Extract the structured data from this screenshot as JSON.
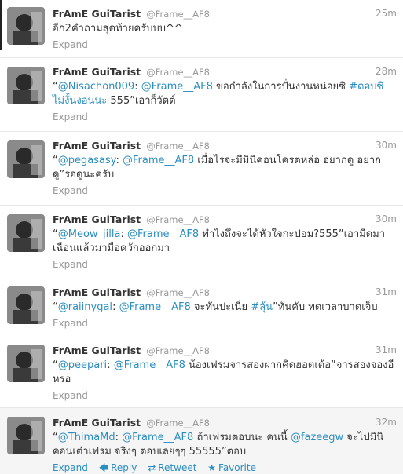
{
  "tweets": [
    {
      "name": "FrAmE GuiTarist",
      "handle": "@Frame__AF8",
      "time": "25m",
      "text_parts": [
        {
          "t": "อีก2คำถามสุดท้ายครับบบ^^",
          "k": "text"
        }
      ],
      "expand": "Expand"
    },
    {
      "name": "FrAmE GuiTarist",
      "handle": "@Frame__AF8",
      "time": "28m",
      "text_parts": [
        {
          "t": "“",
          "k": "text"
        },
        {
          "t": "@Nisachon009",
          "k": "mention"
        },
        {
          "t": ": ",
          "k": "text"
        },
        {
          "t": "@Frame__AF8",
          "k": "mention"
        },
        {
          "t": " ขอกำลังในการปั่นงานหน่อยซิ ",
          "k": "text"
        },
        {
          "t": "#ตอบซิ",
          "k": "mention"
        },
        {
          "t": " ",
          "k": "text"
        },
        {
          "t": "ไม่งั้นงอนนะ",
          "k": "mention"
        },
        {
          "t": " 555”เอาก็วัตต์",
          "k": "text"
        }
      ],
      "expand": "Expand"
    },
    {
      "name": "FrAmE GuiTarist",
      "handle": "@Frame__AF8",
      "time": "30m",
      "text_parts": [
        {
          "t": "“",
          "k": "text"
        },
        {
          "t": "@pegasasy",
          "k": "mention"
        },
        {
          "t": ": ",
          "k": "text"
        },
        {
          "t": "@Frame__AF8",
          "k": "mention"
        },
        {
          "t": " เมื่อไรจะมีมินิคอนโครตหล่อ อยากดู อยากดู”รอดูนะครับ",
          "k": "text"
        }
      ],
      "expand": "Expand"
    },
    {
      "name": "FrAmE GuiTarist",
      "handle": "@Frame__AF8",
      "time": "30m",
      "text_parts": [
        {
          "t": "“",
          "k": "text"
        },
        {
          "t": "@Meow_jilla",
          "k": "mention"
        },
        {
          "t": ": ",
          "k": "text"
        },
        {
          "t": "@Frame__AF8",
          "k": "mention"
        },
        {
          "t": " ทำไงถึงจะได้หัวใจกะปอม?555”เอามีดมาเฉือนแล้วมามือควักออกมา",
          "k": "text"
        }
      ],
      "expand": "Expand"
    },
    {
      "name": "FrAmE GuiTarist",
      "handle": "@Frame__AF8",
      "time": "31m",
      "text_parts": [
        {
          "t": "“",
          "k": "text"
        },
        {
          "t": "@raiinygal",
          "k": "mention"
        },
        {
          "t": ": ",
          "k": "text"
        },
        {
          "t": "@Frame__AF8",
          "k": "mention"
        },
        {
          "t": " จะทันปะเนี่ย ",
          "k": "text"
        },
        {
          "t": "#ลุ้น",
          "k": "mention"
        },
        {
          "t": "”ทันคับ ทดเวลาบาดเจ็บ",
          "k": "text"
        }
      ],
      "expand": "Expand"
    },
    {
      "name": "FrAmE GuiTarist",
      "handle": "@Frame__AF8",
      "time": "31m",
      "text_parts": [
        {
          "t": "“",
          "k": "text"
        },
        {
          "t": "@peepari",
          "k": "mention"
        },
        {
          "t": ": ",
          "k": "text"
        },
        {
          "t": "@Frame__AF8",
          "k": "mention"
        },
        {
          "t": " น้องเฟรมจารสองฝากคิดฮอตเต้อ”จารสองจองอีหรอ",
          "k": "text"
        }
      ],
      "expand": "Expand"
    },
    {
      "name": "FrAmE GuiTarist",
      "handle": "@Frame__AF8",
      "time": "32m",
      "text_parts": [
        {
          "t": "“",
          "k": "text"
        },
        {
          "t": "@ThimaMd",
          "k": "mention"
        },
        {
          "t": ": ",
          "k": "text"
        },
        {
          "t": "@Frame__AF8",
          "k": "mention"
        },
        {
          "t": " ถ้าเฟรมตอบนะ คนนี้ ",
          "k": "text"
        },
        {
          "t": "@fazeegw",
          "k": "mention"
        },
        {
          "t": " จะไปมินิคอนเต๋าเฟรม จริงๆ ตอบเลยๆๆ 55555”ตอบ",
          "k": "text"
        }
      ],
      "expand": "Expand",
      "reply": "Reply",
      "retweet": "Retweet",
      "favorite": "Favorite"
    }
  ]
}
